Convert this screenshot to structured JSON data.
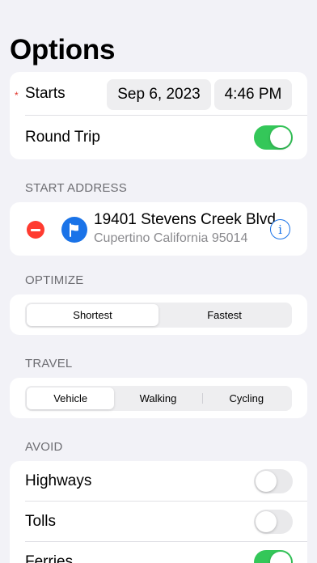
{
  "page": {
    "title": "Options"
  },
  "colors": {
    "accent": "#1a73e8",
    "toggle_on": "#34c759",
    "destructive": "#ff3b30",
    "required": "#e0352b"
  },
  "schedule": {
    "starts_label": "Starts",
    "required_marker": "*",
    "date": "Sep 6, 2023",
    "time": "4:46 PM",
    "round_trip_label": "Round Trip",
    "round_trip_on": true
  },
  "start_address": {
    "header": "START ADDRESS",
    "street": "19401 Stevens Creek Blvd",
    "city": "Cupertino California 95014",
    "remove_icon": "minus-circle-icon",
    "flag_icon": "flag-icon",
    "info_icon": "info-icon"
  },
  "optimize": {
    "header": "OPTIMIZE",
    "options": [
      "Shortest",
      "Fastest"
    ],
    "selected": "Shortest"
  },
  "travel": {
    "header": "TRAVEL",
    "options": [
      "Vehicle",
      "Walking",
      "Cycling"
    ],
    "selected": "Vehicle"
  },
  "avoid": {
    "header": "AVOID",
    "items": [
      {
        "label": "Highways",
        "on": false
      },
      {
        "label": "Tolls",
        "on": false
      },
      {
        "label": "Ferries",
        "on": true
      }
    ]
  }
}
